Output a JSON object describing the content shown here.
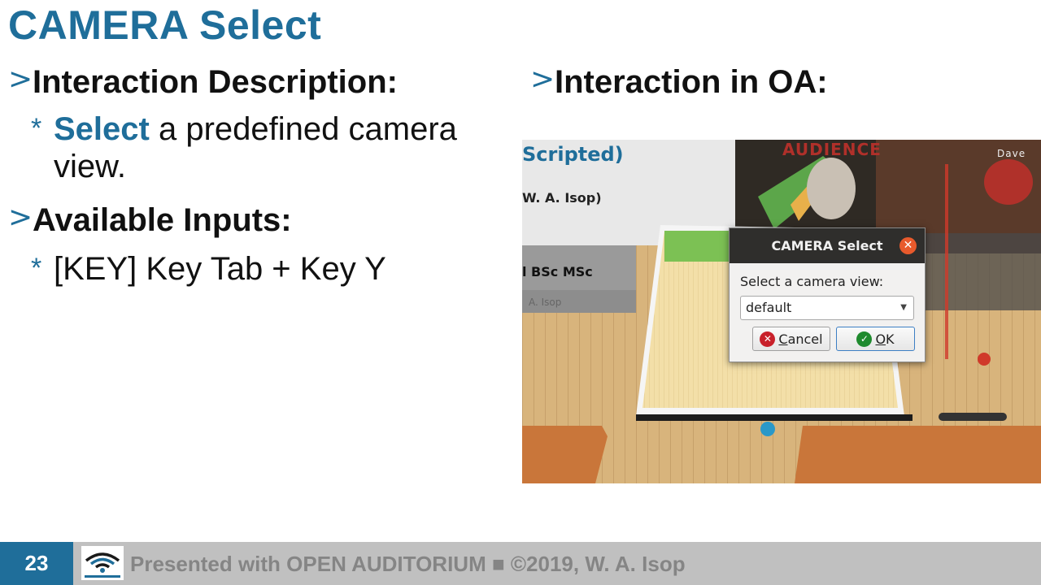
{
  "slide": {
    "title": "CAMERA Select",
    "left": {
      "heading1": "Interaction Description:",
      "desc_highlight": "Select",
      "desc_rest_line1": "a predefined camera",
      "desc_rest_line2": "view.",
      "heading2": "Available Inputs:",
      "input_line": "[KEY] Key Tab + Key Y"
    },
    "right": {
      "heading": "Interaction in OA:"
    },
    "bullet_char": ">",
    "sub_bullet_char": "*"
  },
  "screenshot": {
    "scene": {
      "panel_title_partial": "Scripted)",
      "panel_author_partial": "W. A. Isop)",
      "panel_degree_partial": "l BSc MSc",
      "panel_name_partial": "A. Isop",
      "audience_sign": "AUDIENCE",
      "user_name": "Dave"
    },
    "dialog": {
      "title": "CAMERA Select",
      "label": "Select a camera view:",
      "selected_value": "default",
      "cancel_rest": "ancel",
      "cancel_mnemonic": "C",
      "ok_rest": "K",
      "ok_mnemonic": "O"
    }
  },
  "footer": {
    "page_number": "23",
    "text": "Presented with OPEN AUDITORIUM ■ ©2019, W. A. Isop"
  },
  "colors": {
    "accent": "#1f6e9a",
    "footer_bg": "#c0c0c0",
    "footer_text": "#858585",
    "dialog_close": "#e85a2c"
  }
}
